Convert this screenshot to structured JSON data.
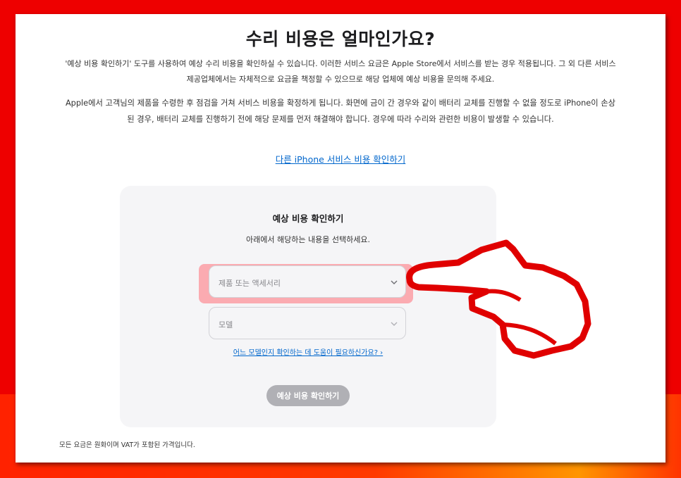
{
  "page": {
    "title": "수리 비용은 얼마인가요?",
    "intro": "'예상 비용 확인하기' 도구를 사용하여 예상 수리 비용을 확인하실 수 있습니다. 이러한 서비스 요금은 Apple Store에서 서비스를 받는 경우 적용됩니다. 그 외 다른 서비스 제공업체에서는 자체적으로 요금을 책정할 수 있으므로 해당 업체에 예상 비용을 문의해 주세요.",
    "notice": "Apple에서 고객님의 제품을 수령한 후 점검을 거쳐 서비스 비용을 확정하게 됩니다. 화면에 금이 간 경우와 같이 배터리 교체를 진행할 수 없을 정도로 iPhone이 손상된 경우, 배터리 교체를 진행하기 전에 해당 문제를 먼저 해결해야 합니다. 경우에 따라 수리와 관련한 비용이 발생할 수 있습니다.",
    "other_services_link": "다른 iPhone 서비스 비용 확인하기"
  },
  "estimate_card": {
    "title": "예상 비용 확인하기",
    "subtitle": "아래에서 해당하는 내용을 선택하세요.",
    "product_select_placeholder": "제품 또는 액세서리",
    "model_select_placeholder": "모델",
    "help_link": "어느 모델인지 확인하는 데 도움이 필요하신가요? ›",
    "submit_button": "예상 비용 확인하기"
  },
  "footnote": "모든 요금은 원화이며 VAT가 포함된 가격입니다.",
  "colors": {
    "frame": "#ee0000",
    "link": "#0066cc",
    "card_background": "#f5f5f7",
    "highlight": "#ff6e78",
    "disabled_button": "#b0b0b5"
  }
}
